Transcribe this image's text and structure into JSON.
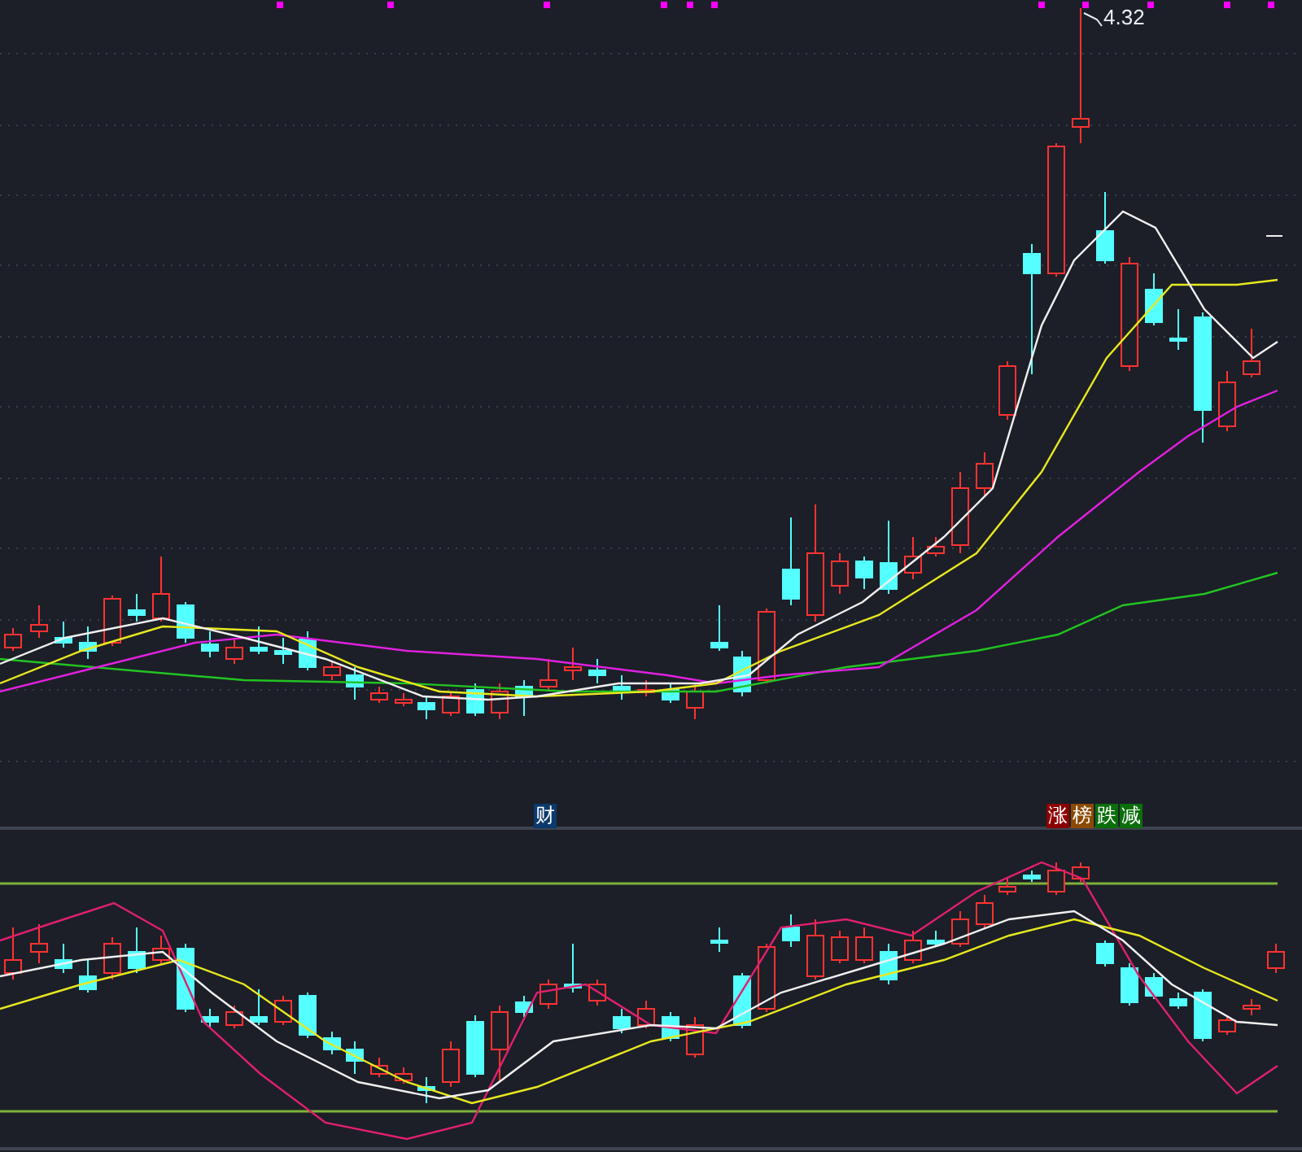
{
  "price_chart": {
    "high_label": "4.32",
    "event_tags": [
      {
        "text": "财",
        "color": "#0b3a6e"
      }
    ],
    "rank_tags": [
      {
        "text": "涨",
        "color": "#8b0000"
      },
      {
        "text": "榜",
        "color": "#8b4a00"
      },
      {
        "text": "跌",
        "color": "#0b6e0b"
      },
      {
        "text": "减",
        "color": "#0b6e0b"
      }
    ]
  }
}
